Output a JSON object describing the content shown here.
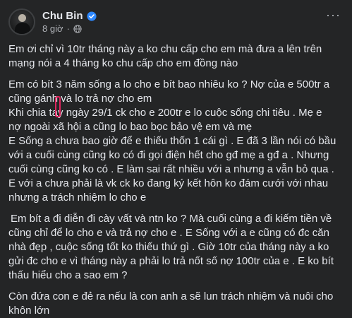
{
  "post": {
    "author": "Chu Bin",
    "verified_icon": "verified-badge-icon",
    "time": "8 giờ",
    "dot": "·",
    "privacy_icon": "globe-icon",
    "more_icon": "more-options-icon",
    "more_label": "···"
  },
  "content": {
    "p1": [
      "Em ơi chỉ vì 10tr tháng này a ko chu cấp cho em mà đưa a lên trên",
      "mạng nói a 4 tháng ko chu cấp cho em đồng nào"
    ],
    "p2": [
      "Em có bít 3 năm sống a lo cho e bít bao nhiêu ko ? Nợ của e 500tr a",
      "cũng gánh và lo trả nợ cho em",
      "Khi chia tay ngày  29/1 ck cho e 200tr e lo cuộc sống chi tiêu . Mẹ e",
      "nợ ngoài xã hội a cũng lo bao bọc bảo vệ em và mẹ",
      "E Sống a chưa bao giờ để e thiếu thốn 1 cái gì . E đã 3 lần nói có bầu",
      "với a cuối cùng cũng ko có đi gọi điện hết cho gđ mẹ a gđ a . Nhưng",
      "cuối cùng cũng ko có . E làm sai rất nhiều với a nhưng a vẫn bỏ qua .",
      "E với a chưa phải là vk ck ko đang ký kết hôn ko đám cưới với nhau",
      "nhưng a trách nhiệm lo cho e"
    ],
    "p3": [
      "Em bít a đi diễn đi cày vất và ntn ko ? Mà cuối cùng a đi kiếm tiền về",
      "cũng chỉ để lo cho e và trả nợ cho e . E Sống với a e cũng có đc căn",
      "nhà đẹp , cuộc sống tốt ko thiếu thứ gì . Giờ 10tr của tháng này a ko",
      "gửi đc cho e vì tháng này a phải lo trả nốt số nợ 100tr của e . E ko bít",
      "thấu hiểu cho a sao em ?"
    ],
    "p4": [
      "Còn đứa con e đẻ ra nếu là con anh a sẽ lun trách nhiệm và nuôi cho",
      "khôn lớn"
    ]
  },
  "colors": {
    "background": "#242526",
    "text": "#e4e6eb",
    "secondary_text": "#b0b3b8",
    "verified_blue": "#2d88ff",
    "highlight_marker": "#e0245e"
  }
}
